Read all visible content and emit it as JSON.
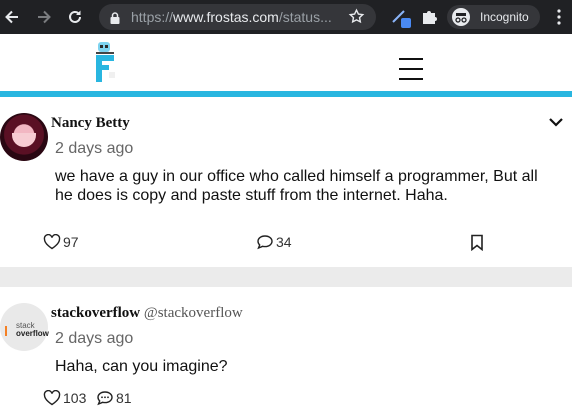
{
  "browser": {
    "url_scheme": "https://",
    "url_host": "www.frostas.com",
    "url_path": "/status...",
    "incognito_label": "Incognito",
    "icons": [
      "back-arrow-icon",
      "forward-arrow-icon",
      "reload-icon",
      "lock-icon",
      "star-icon",
      "pen-extension-icon",
      "puzzle-icon",
      "incognito-icon",
      "kebab-menu-icon"
    ]
  },
  "site": {
    "logo_icon": "frostas-logo-icon",
    "menu_icon": "hamburger-menu-icon",
    "accent_color": "#29b6e0"
  },
  "posts": [
    {
      "author": "Nancy Betty",
      "handle": "",
      "time": "2 days ago",
      "text": "we have a guy in our office who called himself a programmer, But all he does is copy and paste stuff from the internet. Haha.",
      "likes": "97",
      "comments": "34"
    },
    {
      "author": "stackoverflow",
      "handle": "@stackoverflow",
      "time": "2 days ago",
      "text": "Haha, can you imagine?",
      "likes": "103",
      "comments": "81",
      "avatar_text_top": "stack",
      "avatar_text_bottom": "overflow"
    }
  ]
}
